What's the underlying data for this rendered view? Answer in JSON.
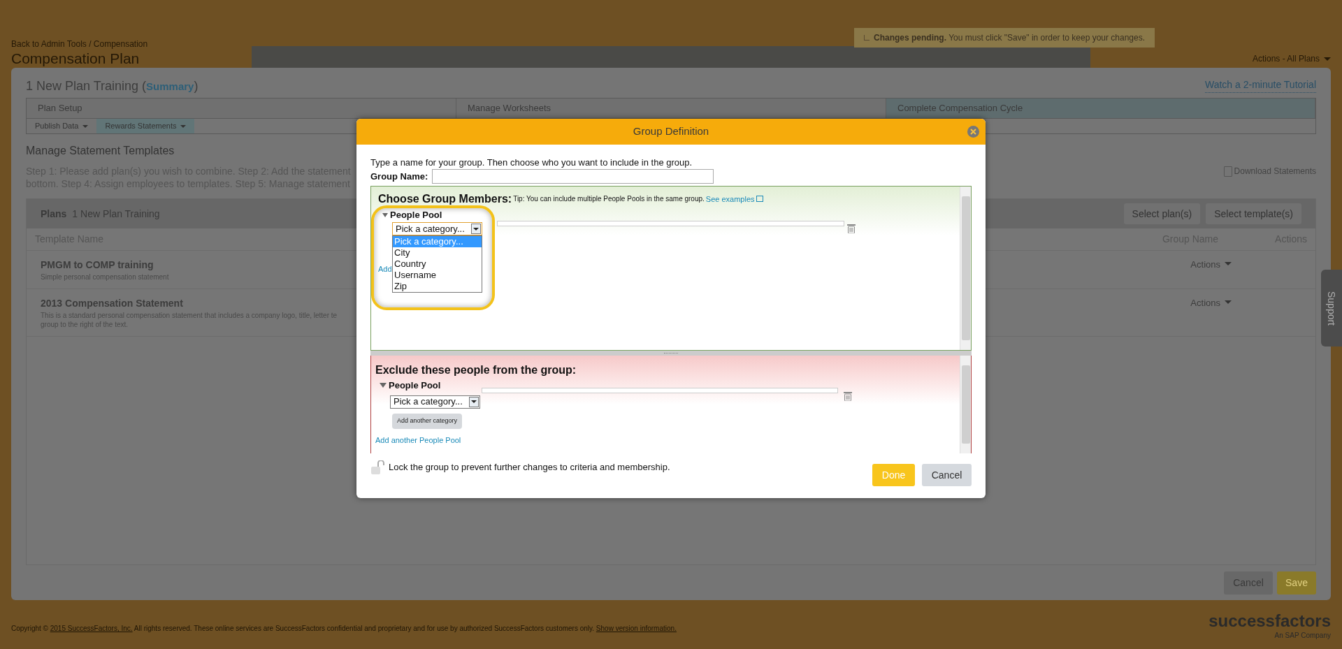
{
  "header": {
    "breadcrumb": "Back to Admin Tools / Compensation",
    "title": "Compensation Plan",
    "notice": {
      "bold": "Changes pending.",
      "text": "You must click \"Save\" in order to keep your changes."
    },
    "actions_menu": "Actions - All Plans"
  },
  "plan": {
    "name": "1 New Plan Training",
    "paren_open": "(",
    "summary_link": "Summary",
    "paren_close": ")",
    "tutorial_link": "Watch a 2-minute Tutorial"
  },
  "steps": [
    {
      "label": "Plan Setup",
      "selected": false
    },
    {
      "label": "Manage Worksheets",
      "selected": false
    },
    {
      "label": "Complete Compensation Cycle",
      "selected": true
    }
  ],
  "subtabs": [
    {
      "label": "Publish Data",
      "selected": false
    },
    {
      "label": "Rewards Statements",
      "selected": true
    }
  ],
  "section": {
    "title": "Manage Statement Templates",
    "lines": [
      "Step 1: Please add plan(s) you wish to combine. Step 2: Add the statement",
      "bottom. Step 4: Assign employees to templates. Step 5: Manage statement"
    ],
    "download": "Download Statements"
  },
  "table": {
    "plans_label": "Plans",
    "plans_value": "1 New Plan Training",
    "buttons": [
      "Select plan(s)",
      "Select template(s)"
    ],
    "columns": [
      "Template Name",
      "Group Name",
      "Actions"
    ],
    "rows": [
      {
        "name": "PMGM to COMP training",
        "description": [
          "Simple personal compensation statement"
        ],
        "actions": "Actions"
      },
      {
        "name": "2013 Compensation Statement",
        "description": [
          "This is a standard personal compensation statement that includes a company logo, title, letter te",
          "group to the right of the text."
        ],
        "actions": "Actions"
      }
    ]
  },
  "page_buttons": [
    {
      "label": "Cancel",
      "kind": "secondary"
    },
    {
      "label": "Save",
      "kind": "primary"
    }
  ],
  "footer": {
    "text_before": "Copyright © ",
    "link1": "2015 SuccessFactors, Inc.",
    "text_middle": " All rights reserved. These online services are SuccessFactors confidential and proprietary and for use by authorized SuccessFactors customers only.",
    "link2": "Show version information.",
    "logo": "successfactors",
    "logo_sub": "An SAP Company"
  },
  "support_tab": "Support",
  "dialog": {
    "title": "Group Definition",
    "intro": "Type a name for your group. Then choose who you want to include in the group.",
    "group_name_label": "Group Name:",
    "include": {
      "heading": "Choose Group Members:",
      "tip": "Tip: You can include multiple People Pools in the same group.",
      "examples_link": "See examples",
      "pool": "People Pool",
      "select_value": "Pick a category...",
      "options": [
        {
          "label": "Pick a category...",
          "selected": true
        },
        {
          "label": "City",
          "selected": false
        },
        {
          "label": "Country",
          "selected": false
        },
        {
          "label": "Username",
          "selected": false
        },
        {
          "label": "Zip",
          "selected": false
        }
      ],
      "hidden_link": "Add"
    },
    "exclude": {
      "heading": "Exclude these people from the group:",
      "pool": "People Pool",
      "select_value": "Pick a category...",
      "add_category": "Add another category",
      "add_pool": "Add another People Pool"
    },
    "lock_text": "Lock the group to prevent further changes to criteria and membership.",
    "buttons": [
      {
        "label": "Done",
        "kind": "primary"
      },
      {
        "label": "Cancel",
        "kind": "secondary"
      }
    ]
  }
}
